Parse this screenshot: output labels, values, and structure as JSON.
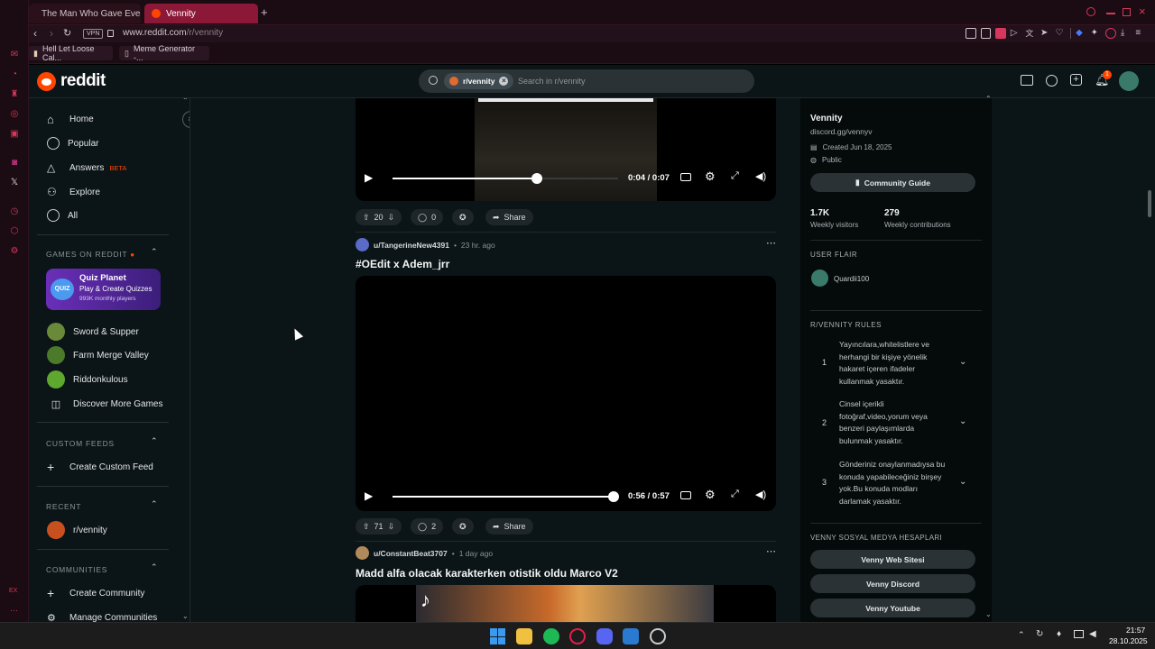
{
  "browser": {
    "tabs": [
      {
        "label": "The Man Who Gave Every"
      },
      {
        "label": "Vennity"
      }
    ],
    "url_prefix": "www.reddit.com",
    "url_path": "/r/vennity",
    "vpn_label": "VPN",
    "bookmarks": [
      {
        "label": "Hell Let Loose Cal..."
      },
      {
        "label": "Meme Generator -..."
      }
    ],
    "sidebar_left_bottom": "EX"
  },
  "reddit": {
    "logo_text": "reddit",
    "search": {
      "chip": "r/vennity",
      "placeholder": "Search in r/vennity"
    },
    "notification_count": "1"
  },
  "leftnav": {
    "items": [
      {
        "label": "Home"
      },
      {
        "label": "Popular"
      },
      {
        "label": "Answers",
        "badge": "BETA"
      },
      {
        "label": "Explore"
      },
      {
        "label": "All"
      }
    ],
    "games_header": "GAMES ON REDDIT",
    "promo": {
      "title": "Quiz Planet",
      "subtitle": "Play & Create Quizzes",
      "stat": "993K monthly players",
      "badge": "QUIZ"
    },
    "games": [
      {
        "label": "Sword & Supper",
        "color": "#6a8a3a"
      },
      {
        "label": "Farm Merge Valley",
        "color": "#4a7a2a"
      },
      {
        "label": "Riddonkulous",
        "color": "#5fa82f"
      },
      {
        "label": "Discover More Games"
      }
    ],
    "custom_feeds_header": "CUSTOM FEEDS",
    "create_custom_feed": "Create Custom Feed",
    "recent_header": "RECENT",
    "recent_item": "r/vennity",
    "communities_header": "COMMUNITIES",
    "create_community": "Create Community",
    "manage_communities": "Manage Communities"
  },
  "feed": {
    "post1": {
      "time": "0:04 / 0:07",
      "progress": 0.64,
      "votes": "20",
      "comments": "0",
      "share": "Share"
    },
    "post2": {
      "author": "u/TangerineNew4391",
      "age": "23 hr. ago",
      "title": "#OEdit x Adem_jrr",
      "time": "0:56 / 0:57",
      "progress": 0.98,
      "votes": "71",
      "comments": "2",
      "share": "Share"
    },
    "post3": {
      "author": "u/ConstantBeat3707",
      "age": "1 day ago",
      "title": "Madd alfa olacak karakterken otistik oldu Marco V2"
    }
  },
  "sidebar": {
    "name": "Vennity",
    "link": "discord.gg/vennyv",
    "created": "Created Jun 18, 2025",
    "visibility": "Public",
    "guide_button": "Community Guide",
    "stats": [
      {
        "value": "1.7K",
        "label": "Weekly visitors"
      },
      {
        "value": "279",
        "label": "Weekly contributions"
      }
    ],
    "user_flair_header": "USER FLAIR",
    "flair_name": "Quardii100",
    "rules_header": "R/VENNITY RULES",
    "rules": [
      {
        "num": "1",
        "text": "Yayıncılara,whitelistlere ve herhangi bir kişiye yönelik hakaret içeren ifadeler kullanmak yasaktır."
      },
      {
        "num": "2",
        "text": "Cinsel içerikli fotoğraf,video,yorum veya benzeri paylaşımlarda bulunmak yasaktır."
      },
      {
        "num": "3",
        "text": "Gönderiniz onaylanmadıysa bu konuda yapabileceğiniz birşey yok.Bu konuda modları darlamak yasaktır."
      }
    ],
    "social_header": "VENNY SOSYAL MEDYA HESAPLARI",
    "social_links": [
      {
        "label": "Venny Web Sitesi"
      },
      {
        "label": "Venny Discord"
      },
      {
        "label": "Venny Youtube"
      }
    ]
  },
  "taskbar": {
    "time": "21:57",
    "date": "28.10.2025"
  }
}
